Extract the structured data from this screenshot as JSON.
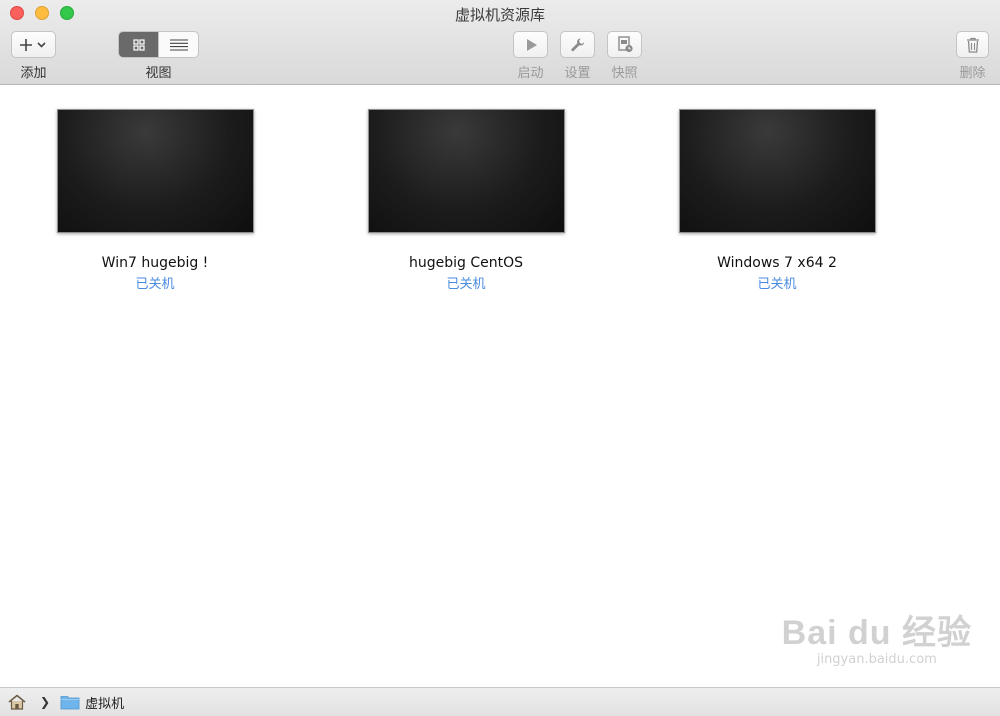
{
  "window": {
    "title": "虚拟机资源库"
  },
  "toolbar": {
    "add_label": "添加",
    "view_label": "视图",
    "start_label": "启动",
    "settings_label": "设置",
    "snapshot_label": "快照",
    "delete_label": "删除",
    "view_mode_selected": "grid"
  },
  "vms": [
    {
      "name": "Win7 hugebig !",
      "status": "已关机"
    },
    {
      "name": "hugebig CentOS",
      "status": "已关机"
    },
    {
      "name": "Windows 7 x64 2",
      "status": "已关机"
    }
  ],
  "statusbar": {
    "path_folder": "虚拟机"
  },
  "watermark": {
    "main": "Bai du 经验",
    "sub": "jingyan.baidu.com"
  },
  "colors": {
    "status_text": "#4a8be0",
    "close": "#fc605c",
    "minimize": "#fdbc40",
    "maximize": "#34c84a"
  }
}
